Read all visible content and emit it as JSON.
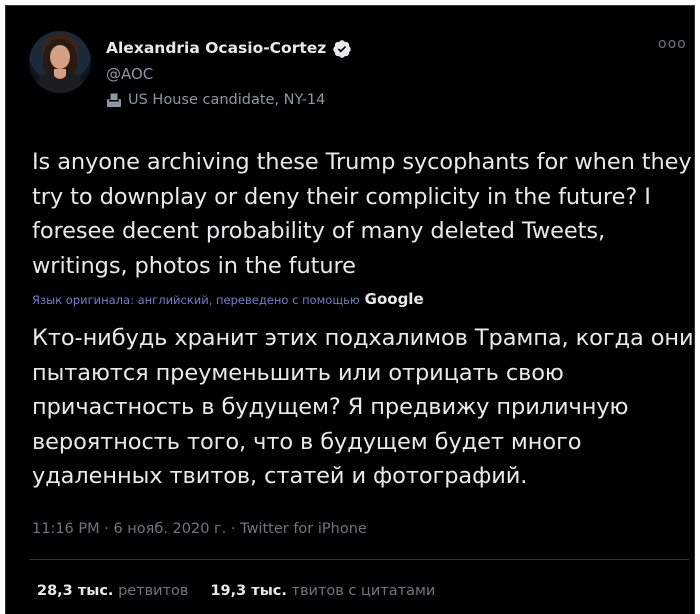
{
  "author": {
    "name": "Alexandria Ocasio-Cortez",
    "handle": "@AOC",
    "label": "US House candidate, NY-14"
  },
  "tweet": {
    "text": "Is anyone archiving these Trump sycophants for when they try to downplay or deny their complicity in the future? I foresee decent probability of many deleted Tweets, writings, photos in the future",
    "translated_note": "Язык оригинала: английский, переведено с помощью",
    "translator": "Google",
    "translation": "Кто-нибудь хранит этих подхалимов Трампа, когда они пытаются преуменьшить или отрицать свою причастность в будущем? Я предвижу приличную вероятность того, что в будущем будет много удаленных твитов, статей и фотографий.",
    "timestamp": "11:16 PM · 6 нояб. 2020 г. · Twitter for iPhone"
  },
  "stats": {
    "retweets_count": "28,3 тыс.",
    "retweets_label": "ретвитов",
    "quotes_count": "19,3 тыс.",
    "quotes_label": "твитов с цитатами"
  },
  "more_label": "ooo",
  "colors": {
    "background": "#000000",
    "text": "#e7e9ea",
    "muted": "#6e767d",
    "verified": "#e7e9ea",
    "translation_link": "#6e7fd0"
  },
  "icons": {
    "verified": "verified-badge-icon",
    "label": "ballot-box-icon",
    "more": "more-options-icon"
  }
}
